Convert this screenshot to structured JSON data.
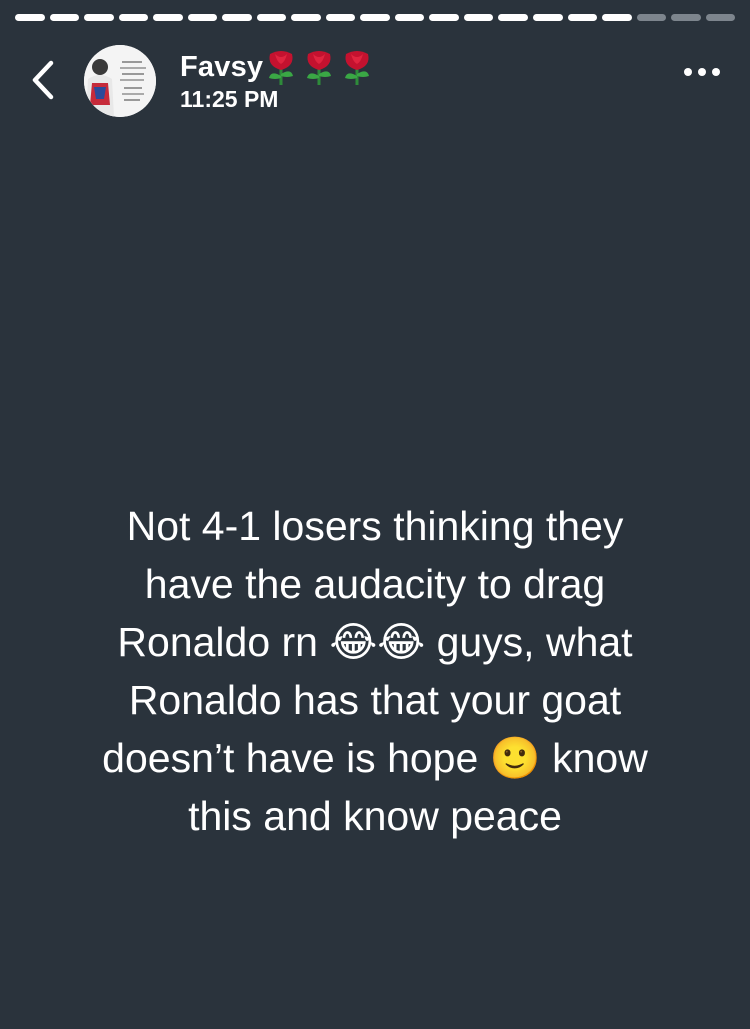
{
  "progress": {
    "total": 21,
    "viewed": 18
  },
  "header": {
    "name": "Favsy",
    "name_emoji": "🌹🌹🌹",
    "time": "11:25 PM"
  },
  "icons": {
    "back": "chevron-left-icon",
    "more": "more-horizontal-icon",
    "rose": "rose-icon"
  },
  "status": {
    "text": "Not 4-1 losers thinking they\nhave the audacity to drag\nRonaldo rn 😂😂 guys, what\nRonaldo has that your goat\ndoesn’t have is hope 🙂 know\nthis and know peace"
  },
  "colors": {
    "background": "#2a333c",
    "progress_active": "#ffffff",
    "progress_pending": "#7d858d"
  }
}
